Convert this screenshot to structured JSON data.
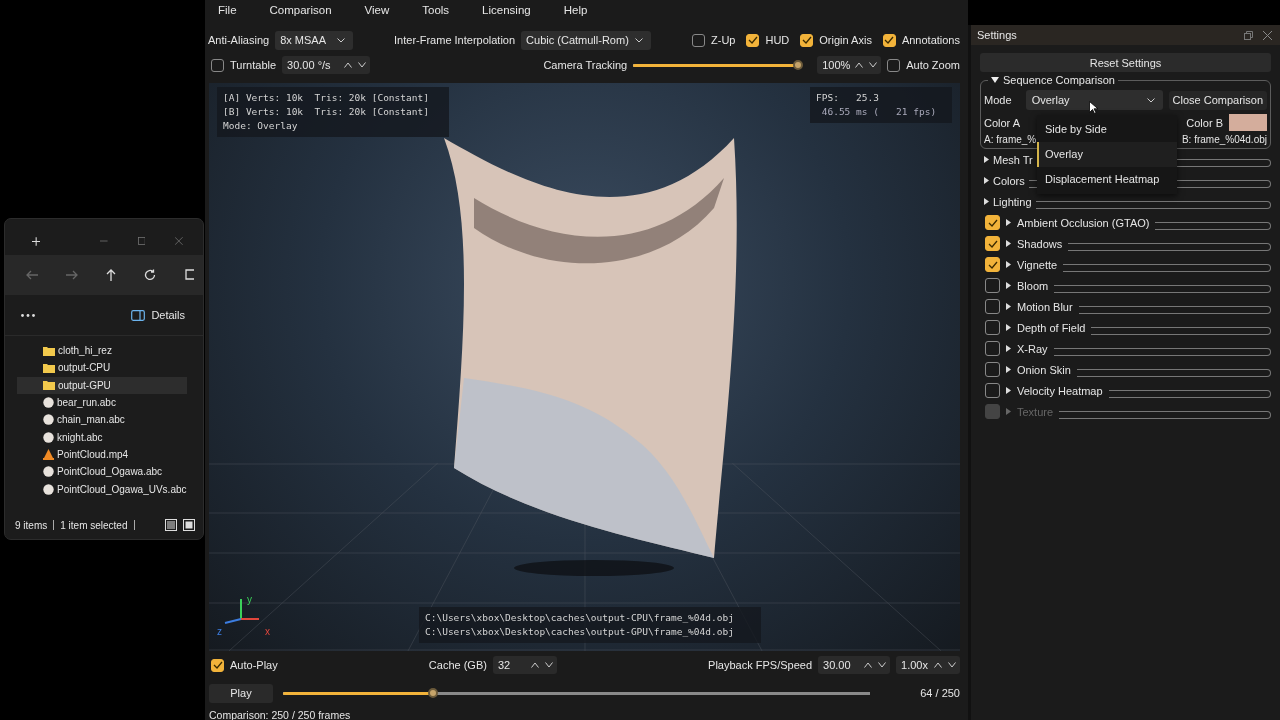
{
  "explorer": {
    "details_label": "Details",
    "files": [
      {
        "name": "cloth_hi_rez",
        "kind": "folder",
        "selected": false
      },
      {
        "name": "output-CPU",
        "kind": "folder",
        "selected": false
      },
      {
        "name": "output-GPU",
        "kind": "folder",
        "selected": true
      },
      {
        "name": "bear_run.abc",
        "kind": "alembic",
        "selected": false
      },
      {
        "name": "chain_man.abc",
        "kind": "alembic",
        "selected": false
      },
      {
        "name": "knight.abc",
        "kind": "alembic",
        "selected": false
      },
      {
        "name": "PointCloud.mp4",
        "kind": "video",
        "selected": false
      },
      {
        "name": "PointCloud_Ogawa.abc",
        "kind": "alembic",
        "selected": false
      },
      {
        "name": "PointCloud_Ogawa_UVs.abc",
        "kind": "alembic",
        "selected": false
      }
    ],
    "status": [
      "9 items",
      "1 item selected"
    ]
  },
  "menu": [
    "File",
    "Comparison",
    "View",
    "Tools",
    "Licensing",
    "Help"
  ],
  "toolbar": {
    "anti_aliasing": {
      "label": "Anti-Aliasing",
      "value": "8x MSAA"
    },
    "interpolation": {
      "label": "Inter-Frame Interpolation",
      "value": "Cubic (Catmull-Rom)"
    },
    "toggles": [
      {
        "label": "Z-Up",
        "checked": false
      },
      {
        "label": "HUD",
        "checked": true
      },
      {
        "label": "Origin Axis",
        "checked": true
      },
      {
        "label": "Annotations",
        "checked": true
      }
    ],
    "turntable": {
      "label": "Turntable",
      "checked": false,
      "value": "30.00 °/s"
    },
    "camera_tracking": {
      "label": "Camera Tracking",
      "level": 0.98
    },
    "zoom": {
      "value": "100%"
    },
    "auto_zoom": {
      "label": "Auto Zoom",
      "checked": false
    }
  },
  "viewport": {
    "hud": [
      "[A] Verts: 10k  Tris: 20k [Constant]",
      "[B] Verts: 10k  Tris: 20k [Constant]",
      "Mode: Overlay"
    ],
    "fps": [
      "FPS:   25.3",
      " 46.55 ms (   21 fps)"
    ],
    "axes": [
      "y",
      "z",
      "x"
    ],
    "paths": [
      "C:\\Users\\xbox\\Desktop\\caches\\output-CPU\\frame_%04d.obj",
      "C:\\Users\\xbox\\Desktop\\caches\\output-GPU\\frame_%04d.obj"
    ]
  },
  "playback": {
    "auto_play": {
      "label": "Auto-Play",
      "checked": true
    },
    "cache": {
      "label": "Cache (GB)",
      "value": "32"
    },
    "speed": {
      "label": "Playback FPS/Speed",
      "fps": "30.00",
      "rate": "1.00x"
    },
    "play": "Play",
    "timeline": {
      "level": 0.256,
      "reading": "64 / 250"
    },
    "status": "Comparison: 250 / 250 frames"
  },
  "settings": {
    "title": "Settings",
    "reset": "Reset Settings",
    "comparison": {
      "title": "Sequence Comparison",
      "mode_label": "Mode",
      "mode": "Overlay",
      "close": "Close Comparison",
      "color_a_label": "Color A",
      "color_b_label": "Color B",
      "file_a": "A: frame_%",
      "file_b": "B: frame_%04d.obj",
      "options": [
        {
          "label": "Side by Side",
          "selected": false
        },
        {
          "label": "Overlay",
          "selected": true
        },
        {
          "label": "Displacement Heatmap",
          "selected": false
        }
      ]
    },
    "groups": [
      {
        "label": "Mesh Tr"
      },
      {
        "label": "Colors"
      },
      {
        "label": "Lighting"
      }
    ],
    "effects": [
      {
        "label": "Ambient Occlusion (GTAO)",
        "checked": true,
        "disabled": false
      },
      {
        "label": "Shadows",
        "checked": true,
        "disabled": false
      },
      {
        "label": "Vignette",
        "checked": true,
        "disabled": false
      },
      {
        "label": "Bloom",
        "checked": false,
        "disabled": false
      },
      {
        "label": "Motion Blur",
        "checked": false,
        "disabled": false
      },
      {
        "label": "Depth of Field",
        "checked": false,
        "disabled": false
      },
      {
        "label": "X-Ray",
        "checked": false,
        "disabled": false
      },
      {
        "label": "Onion Skin",
        "checked": false,
        "disabled": false
      },
      {
        "label": "Velocity Heatmap",
        "checked": false,
        "disabled": false
      },
      {
        "label": "Texture",
        "checked": false,
        "disabled": true
      }
    ]
  }
}
